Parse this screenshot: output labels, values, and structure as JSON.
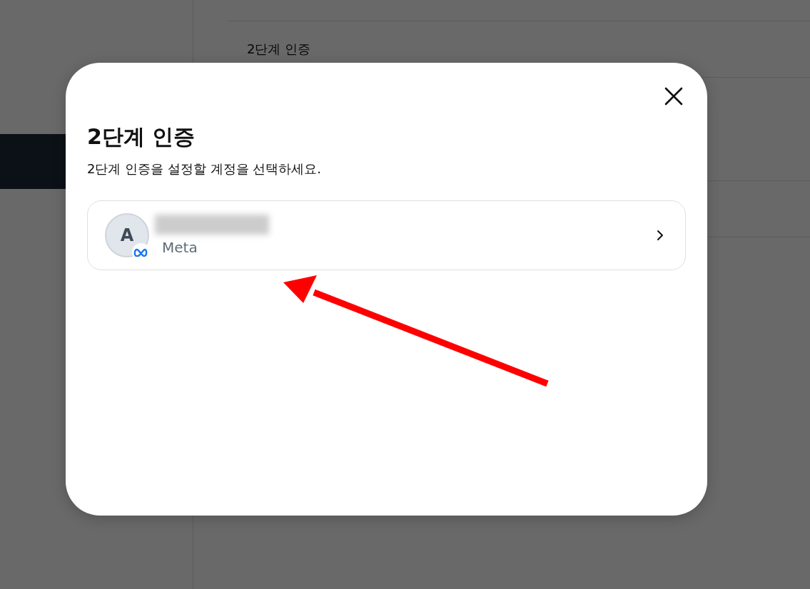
{
  "background": {
    "rows": [
      {
        "label": "2단계 인증"
      }
    ]
  },
  "dialog": {
    "title": "2단계 인증",
    "subtitle": "2단계 인증을 설정할 계정을 선택하세요.",
    "accounts": [
      {
        "initial": "A",
        "name_redacted": true,
        "provider": "Meta"
      }
    ]
  },
  "annotations": [
    {
      "kind": "arrow"
    }
  ]
}
